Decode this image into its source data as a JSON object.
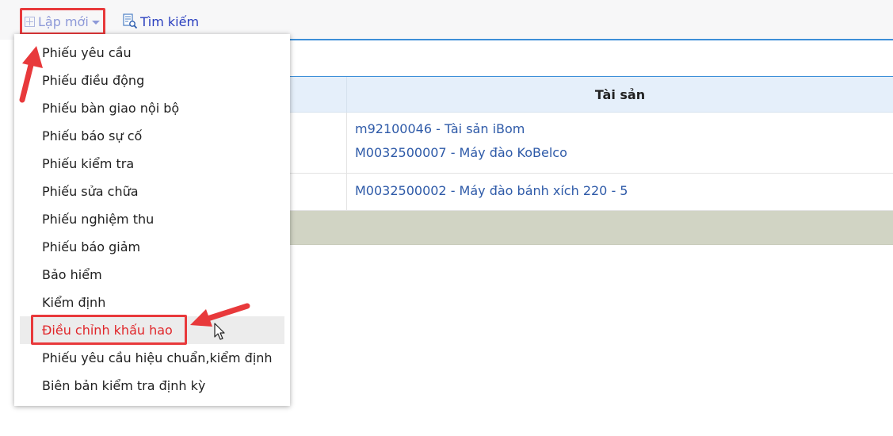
{
  "toolbar": {
    "new_label": "Lập mới",
    "search_label": "Tìm kiếm"
  },
  "grid": {
    "column_asset": "Tài sản",
    "rows": [
      {
        "assets": [
          "m92100046 - Tài sản iBom",
          "M0032500007 - Máy đào KoBelco"
        ]
      },
      {
        "assets": [
          "M0032500002 - Máy đào bánh xích 220 - 5"
        ]
      }
    ]
  },
  "menu": {
    "items": [
      "Phiếu yêu cầu",
      "Phiếu điều động",
      "Phiếu bàn giao nội bộ",
      "Phiếu báo sự cố",
      "Phiếu kiểm tra",
      "Phiếu sửa chữa",
      "Phiếu nghiệm thu",
      "Phiếu báo giảm",
      "Bảo hiểm",
      "Kiểm định",
      "Điều chỉnh khấu hao",
      "Phiếu yêu cầu hiệu chuẩn,kiểm định",
      "Biên bản kiểm tra định kỳ"
    ],
    "hovered_item": "Điều chỉnh khấu hao"
  },
  "colors": {
    "annotation_red": "#e8393b",
    "link_blue": "#2e5aa8",
    "header_bg": "#e5effa",
    "footer_bg": "#d1d4c4"
  }
}
